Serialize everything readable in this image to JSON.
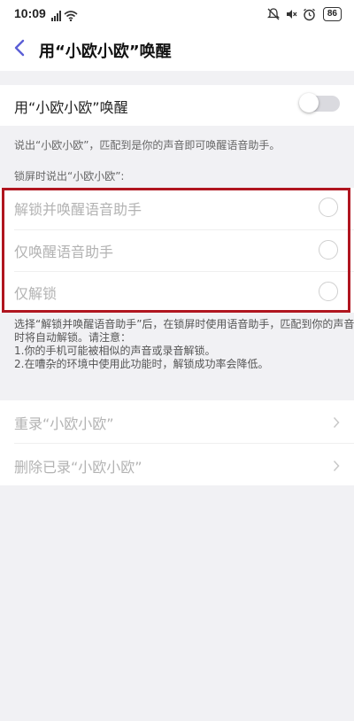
{
  "status_bar": {
    "time": "10:09",
    "battery": "86",
    "icons": [
      "signal-icon",
      "wifi-icon",
      "alarm-off-icon",
      "mute-icon",
      "alarm-icon"
    ]
  },
  "header": {
    "title": "用“小欧小欧”唤醒"
  },
  "wake_setting": {
    "label": "用“小欧小欧”唤醒",
    "enabled": false,
    "description": "说出“小欧小欧”，匹配到是你的声音即可唤醒语音助手。"
  },
  "lock_section": {
    "heading": "锁屏时说出“小欧小欧”:",
    "options": [
      {
        "label": "解锁并唤醒语音助手",
        "selected": false
      },
      {
        "label": "仅唤醒语音助手",
        "selected": false
      },
      {
        "label": "仅解锁",
        "selected": false
      }
    ],
    "highlight_color": "#b0151f"
  },
  "note": {
    "lines": [
      "选择“解锁并唤醒语音助手”后，在锁屏时使用语音助手，匹配到你的声音",
      "时将自动解锁。请注意：",
      "1.你的手机可能被相似的声音或录音解锁。",
      "2.在嘈杂的环境中使用此功能时，解锁成功率会降低。"
    ]
  },
  "actions": {
    "rerecord": "重录“小欧小欧”",
    "delete": "删除已录“小欧小欧”"
  },
  "colors": {
    "accent": "#5b5fd6",
    "disabled_text": "#b3b3b3",
    "background": "#f1f1f4"
  }
}
